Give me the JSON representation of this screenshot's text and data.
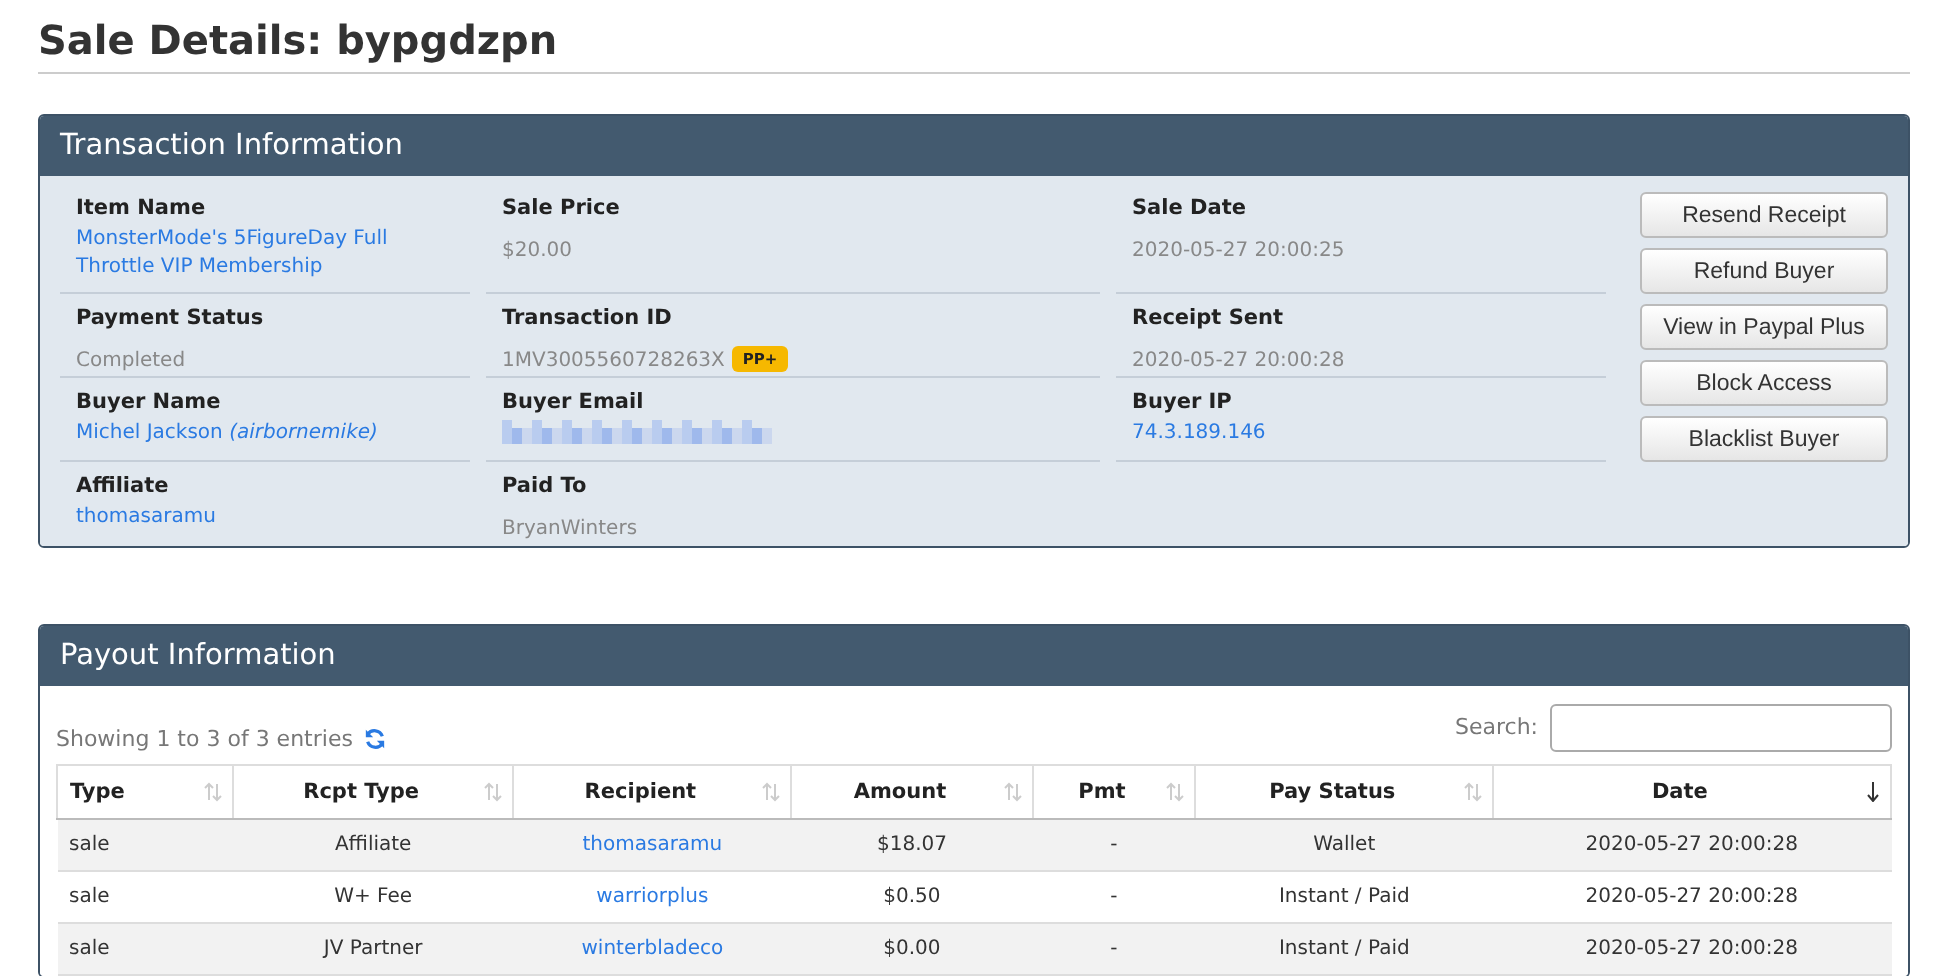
{
  "page_title": "Sale Details: bypgdzpn",
  "transaction": {
    "title": "Transaction Information",
    "rows": [
      [
        {
          "label": "Item Name",
          "value": "MonsterMode's 5FigureDay Full Throttle VIP Membership",
          "kind": "link"
        },
        {
          "label": "Sale Price",
          "value": "$20.00",
          "kind": "text"
        },
        {
          "label": "Sale Date",
          "value": "2020-05-27 20:00:25",
          "kind": "text"
        }
      ],
      [
        {
          "label": "Payment Status",
          "value": "Completed",
          "kind": "text"
        },
        {
          "label": "Transaction ID",
          "value": "1MV3005560728263X",
          "kind": "text",
          "badge": "PP+"
        },
        {
          "label": "Receipt Sent",
          "value": "2020-05-27 20:00:28",
          "kind": "text"
        }
      ],
      [
        {
          "label": "Buyer Name",
          "value": "Michel Jackson *(airbornemike)*",
          "kind": "link"
        },
        {
          "label": "Buyer Email",
          "kind": "redacted"
        },
        {
          "label": "Buyer IP",
          "value": "74.3.189.146",
          "kind": "link"
        }
      ],
      [
        {
          "label": "Affiliate",
          "value": "thomasaramu",
          "kind": "link"
        },
        {
          "label": "Paid To",
          "value": "BryanWinters",
          "kind": "text"
        }
      ]
    ],
    "buttons": [
      "Resend Receipt",
      "Refund Buyer",
      "View in Paypal Plus",
      "Block Access",
      "Blacklist Buyer"
    ]
  },
  "payout": {
    "title": "Payout Information",
    "info": "Showing 1 to 3 of 3 entries",
    "search_label": "Search:",
    "columns": [
      {
        "label": "Type",
        "sorted": false
      },
      {
        "label": "Rcpt Type",
        "sorted": false
      },
      {
        "label": "Recipient",
        "sorted": false
      },
      {
        "label": "Amount",
        "sorted": false
      },
      {
        "label": "Pmt",
        "sorted": false
      },
      {
        "label": "Pay Status",
        "sorted": false
      },
      {
        "label": "Date",
        "sorted": true
      }
    ],
    "rows": [
      [
        "sale",
        "Affiliate",
        "thomasaramu",
        "$18.07",
        "-",
        "Wallet",
        "2020-05-27 20:00:28"
      ],
      [
        "sale",
        "W+ Fee",
        "warriorplus",
        "$0.50",
        "-",
        "Instant / Paid",
        "2020-05-27 20:00:28"
      ],
      [
        "sale",
        "JV Partner",
        "winterbladeco",
        "$0.00",
        "-",
        "Instant / Paid",
        "2020-05-27 20:00:28"
      ]
    ]
  }
}
